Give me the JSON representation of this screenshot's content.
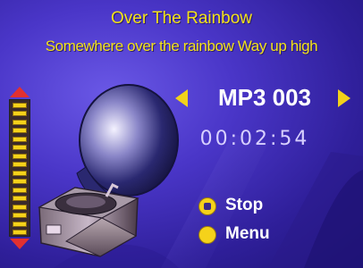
{
  "song": {
    "title": "Over The Rainbow",
    "lyric": "Somewhere over the rainbow Way up high"
  },
  "player": {
    "track_label": "MP3 003",
    "elapsed_time": "00:02:54"
  },
  "controls": {
    "stop_label": "Stop",
    "menu_label": "Menu"
  },
  "volume": {
    "level_fraction": 1.0
  },
  "icons": {
    "gramophone": "gramophone-icon",
    "volume_up": "volume-up-icon",
    "volume_down": "volume-down-icon",
    "prev": "previous-track-icon",
    "next": "next-track-icon",
    "stop": "stop-button-icon",
    "menu": "menu-button-icon"
  },
  "colors": {
    "background": "#4a36c8",
    "text_yellow": "#f2e21a",
    "accent_yellow": "#f5d21a",
    "volume_arrow": "#e23030",
    "label_white": "#ffffff"
  }
}
